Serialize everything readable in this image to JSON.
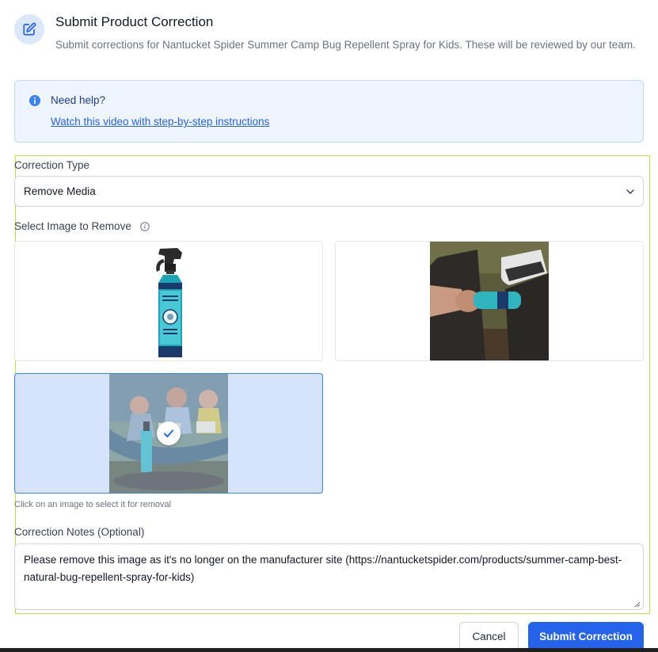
{
  "header": {
    "title": "Submit Product Correction",
    "description": "Submit corrections for Nantucket Spider Summer Camp Bug Repellent Spray for Kids. These will be reviewed by our team.",
    "icon": "edit-icon"
  },
  "help": {
    "title": "Need help?",
    "link_text": "Watch this video with step-by-step instructions",
    "icon": "info-icon"
  },
  "form": {
    "correction_type_label": "Correction Type",
    "correction_type_value": "Remove Media",
    "select_image_label": "Select Image to Remove",
    "images": [
      {
        "description": "spray-bottle-product",
        "selected": false
      },
      {
        "description": "hand-holding-bottle",
        "selected": false
      },
      {
        "description": "kids-reading-with-bottle",
        "selected": true
      }
    ],
    "hint": "Click on an image to select it for removal",
    "notes_label": "Correction Notes (Optional)",
    "notes_value": "Please remove this image as it's no longer on the manufacturer site (https://nantucketspider.com/products/summer-camp-best-natural-bug-repellent-spray-for-kids)"
  },
  "actions": {
    "cancel_label": "Cancel",
    "submit_label": "Submit Correction"
  },
  "colors": {
    "accent": "#2563eb",
    "selected_bg": "#d6e4fb",
    "help_bg": "#eff5fe",
    "focus_outline": "#b6e34a"
  }
}
